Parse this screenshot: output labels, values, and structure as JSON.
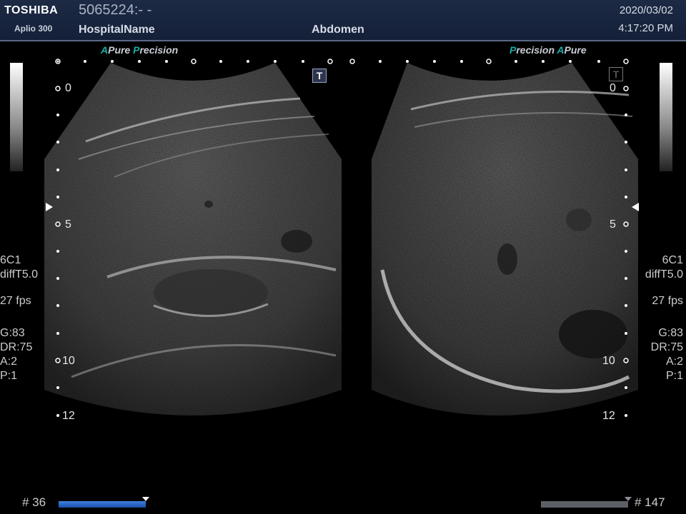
{
  "header": {
    "brand": "TOSHIBA",
    "model": "Aplio 300",
    "patient_id": "5065224:- -",
    "hospital": "HospitalName",
    "exam": "Abdomen",
    "date": "2020/03/02",
    "time": "4:17:20 PM"
  },
  "left_panel": {
    "mode_a": "A",
    "mode_pure": "Pure",
    "mode_p": "P",
    "mode_precision": "recision",
    "tbox": "T",
    "depth_labels": [
      "0",
      "5",
      "10",
      "12"
    ],
    "params": {
      "probe": "6C1",
      "harmonic": "diffT5.0",
      "fps": "27 fps",
      "gain": "G:83",
      "dr": "DR:75",
      "a": "A:2",
      "p": "P:1"
    },
    "frame": "# 36",
    "progress": 1.0
  },
  "right_panel": {
    "mode_p": "P",
    "mode_precision": "recision",
    "mode_a": "A",
    "mode_pure": "Pure",
    "tbox": "T",
    "depth_labels": [
      "0",
      "5",
      "10",
      "12"
    ],
    "params": {
      "probe": "6C1",
      "harmonic": "diffT5.0",
      "fps": "27 fps",
      "gain": "G:83",
      "dr": "DR:75",
      "a": "A:2",
      "p": "P:1"
    },
    "frame": "# 147",
    "progress": 1.0
  },
  "colors": {
    "header_bg": "#1d2a44",
    "accent_teal": "#17b0a8",
    "progress_blue": "#1f63c4",
    "progress_gray": "#5c5f66"
  }
}
